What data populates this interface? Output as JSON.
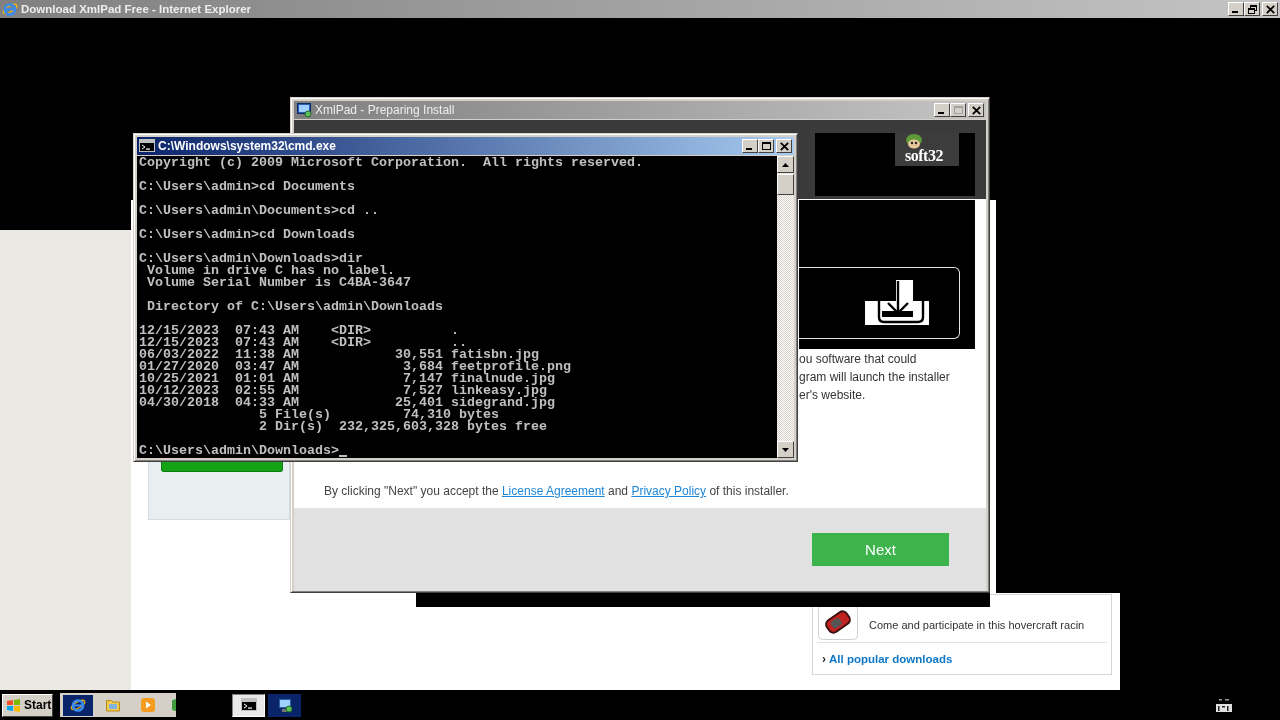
{
  "browser": {
    "title": "Download XmlPad Free - Internet Explorer",
    "active": false,
    "caption_buttons": [
      {
        "kind": "minimize",
        "disabled": false
      },
      {
        "kind": "restore",
        "disabled": false
      },
      {
        "kind": "close",
        "disabled": false
      }
    ]
  },
  "webpage": {
    "popular": {
      "item_text": "Come and participate in this hovercraft racin",
      "link_marker": "›",
      "link": "All popular downloads"
    }
  },
  "installer": {
    "title": "XmlPad - Preparing Install",
    "active": false,
    "caption_buttons": [
      {
        "kind": "minimize",
        "disabled": false
      },
      {
        "kind": "maximize",
        "disabled": true
      },
      {
        "kind": "close",
        "disabled": false
      }
    ],
    "logo": "soft32",
    "description_lines": [
      "ou software that could",
      "gram will launch the installer",
      "er's website."
    ],
    "agreement": [
      {
        "kind": "text",
        "text": "By clicking \"Next\" you accept the "
      },
      {
        "kind": "link",
        "text": "License Agreement"
      },
      {
        "kind": "text",
        "text": " and "
      },
      {
        "kind": "link",
        "text": "Privacy Policy"
      },
      {
        "kind": "text",
        "text": " of this installer."
      }
    ],
    "next_button": "Next"
  },
  "console": {
    "title": "C:\\Windows\\system32\\cmd.exe",
    "active": true,
    "caption_buttons": [
      {
        "kind": "minimize",
        "disabled": false
      },
      {
        "kind": "maximize",
        "disabled": false
      },
      {
        "kind": "close",
        "disabled": false
      }
    ],
    "blocks": [
      [
        "Copyright (c) 2009 Microsoft Corporation.  All rights reserved."
      ],
      [
        "C:\\Users\\admin>cd Documents"
      ],
      [
        "C:\\Users\\admin\\Documents>cd .."
      ],
      [
        "C:\\Users\\admin>cd Downloads"
      ],
      [
        "C:\\Users\\admin\\Downloads>dir",
        " Volume in drive C has no label.",
        " Volume Serial Number is C4BA-3647"
      ],
      [
        " Directory of C:\\Users\\admin\\Downloads"
      ],
      [
        "12/15/2023  07:43 AM    <DIR>          .",
        "12/15/2023  07:43 AM    <DIR>          ..",
        "06/03/2022  11:38 AM            30,551 fatisbn.jpg",
        "01/27/2020  03:47 AM             3,684 feetprofile.png",
        "10/25/2021  01:01 AM             7,147 finalnude.jpg",
        "10/12/2023  02:55 AM             7,527 linkeasy.jpg",
        "04/30/2018  04:33 AM            25,401 sidegrand.jpg",
        "               5 File(s)         74,310 bytes",
        "               2 Dir(s)  232,325,603,328 bytes free"
      ],
      [
        "C:\\Users\\admin\\Downloads>"
      ]
    ],
    "cursor": true
  },
  "taskbar": {
    "start": "Start",
    "quick_launch": [
      {
        "kind": "browser",
        "hovered": true
      },
      {
        "kind": "folder",
        "hovered": false
      },
      {
        "kind": "media",
        "hovered": false
      }
    ],
    "tasks": [
      {
        "kind": "console",
        "selected": true
      },
      {
        "kind": "installer",
        "selected": false
      }
    ]
  }
}
